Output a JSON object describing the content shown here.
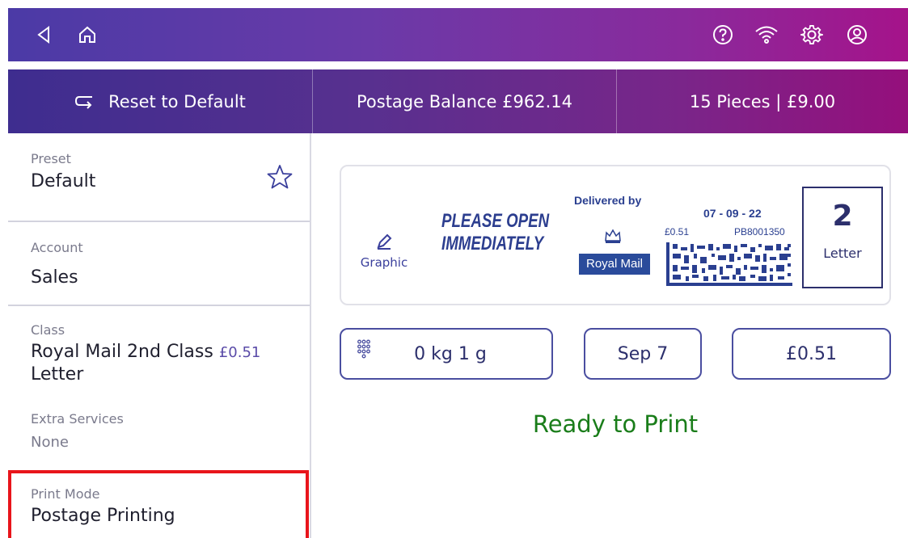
{
  "topbar": {
    "icons": [
      "back-icon",
      "home-icon",
      "help-icon",
      "wifi-icon",
      "settings-icon",
      "account-icon"
    ]
  },
  "subbar": {
    "reset_label": "Reset to Default",
    "postage_balance": "Postage Balance £962.14",
    "pieces": "15 Pieces | £9.00"
  },
  "left_panel": {
    "preset": {
      "label": "Preset",
      "value": "Default"
    },
    "account": {
      "label": "Account",
      "value": "Sales"
    },
    "class": {
      "label": "Class",
      "value_line1": "Royal Mail 2nd Class",
      "price": "£0.51",
      "value_line2": "Letter"
    },
    "extra_services": {
      "label": "Extra Services",
      "value": "None"
    },
    "print_mode": {
      "label": "Print Mode",
      "value": "Postage Printing"
    }
  },
  "stamp": {
    "graphic_label": "Graphic",
    "message_line1": "PLEASE OPEN",
    "message_line2": "IMMEDIATELY",
    "delivered_by": "Delivered by",
    "carrier": "Royal Mail",
    "date": "07 - 09 - 22",
    "value": "£0.51",
    "code": "PB8001350",
    "count": "2",
    "count_label": "Letter"
  },
  "controls": {
    "weight": "0 kg 1 g",
    "date": "Sep 7",
    "amount": "£0.51"
  },
  "status": "Ready to Print",
  "colors": {
    "accent": "#4a4ea0",
    "status_green": "#1a7d1a",
    "highlight_red": "#e8151b"
  }
}
